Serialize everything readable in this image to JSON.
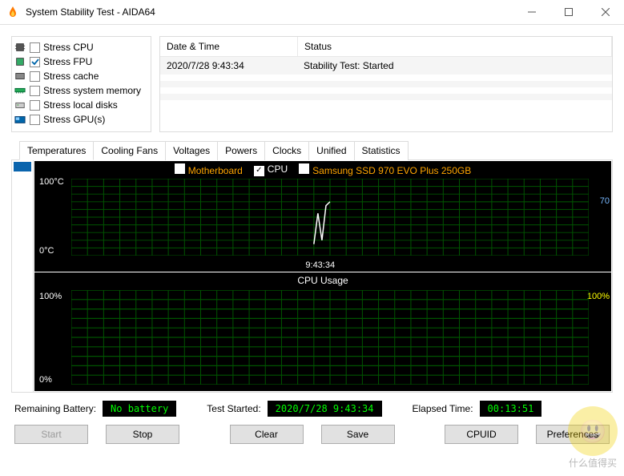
{
  "window": {
    "title": "System Stability Test - AIDA64"
  },
  "stress": [
    {
      "label": "Stress CPU",
      "checked": false,
      "hw": "cpu"
    },
    {
      "label": "Stress FPU",
      "checked": true,
      "hw": "fpu"
    },
    {
      "label": "Stress cache",
      "checked": false,
      "hw": "cache"
    },
    {
      "label": "Stress system memory",
      "checked": false,
      "hw": "mem"
    },
    {
      "label": "Stress local disks",
      "checked": false,
      "hw": "disk"
    },
    {
      "label": "Stress GPU(s)",
      "checked": false,
      "hw": "gpu"
    }
  ],
  "eventlog": {
    "col_date": "Date & Time",
    "col_status": "Status",
    "rows": [
      {
        "date": "2020/7/28 9:43:34",
        "status": "Stability Test: Started"
      }
    ]
  },
  "tabs": [
    "Temperatures",
    "Cooling Fans",
    "Voltages",
    "Powers",
    "Clocks",
    "Unified",
    "Statistics"
  ],
  "active_tab": 0,
  "temp_legend": [
    {
      "label": "Motherboard",
      "color": "#ffa500",
      "checked": false
    },
    {
      "label": "CPU",
      "color": "#ffffff",
      "checked": true
    },
    {
      "label": "Samsung SSD 970 EVO Plus 250GB",
      "color": "#ffa500",
      "checked": false
    }
  ],
  "temp_axis": {
    "y_top": "100°C",
    "y_bot": "0°C",
    "right_mark": "70",
    "x0": "9:43:34"
  },
  "chart_data": {
    "type": "line",
    "title": "Temperatures",
    "ylabel": "°C",
    "ylim": [
      0,
      100
    ],
    "x": [
      "9:43:34"
    ],
    "series": [
      {
        "name": "Motherboard",
        "values": []
      },
      {
        "name": "CPU",
        "values": [
          70
        ]
      },
      {
        "name": "Samsung SSD 970 EVO Plus 250GB",
        "values": []
      }
    ]
  },
  "cpu_usage": {
    "title": "CPU Usage",
    "y_top": "100%",
    "y_bot": "0%",
    "right": "100%"
  },
  "cpu_chart_data": {
    "type": "line",
    "title": "CPU Usage",
    "ylabel": "%",
    "ylim": [
      0,
      100
    ],
    "series": [
      {
        "name": "CPU Usage",
        "values": [
          100
        ]
      }
    ]
  },
  "status": {
    "bat_label": "Remaining Battery:",
    "bat_value": "No battery",
    "start_label": "Test Started:",
    "start_value": "2020/7/28 9:43:34",
    "elapsed_label": "Elapsed Time:",
    "elapsed_value": "00:13:51"
  },
  "buttons": {
    "start": "Start",
    "stop": "Stop",
    "clear": "Clear",
    "save": "Save",
    "cpuid": "CPUID",
    "prefs": "Preferences"
  },
  "watermark": {
    "emoji": "😃",
    "text": "什么值得买"
  }
}
